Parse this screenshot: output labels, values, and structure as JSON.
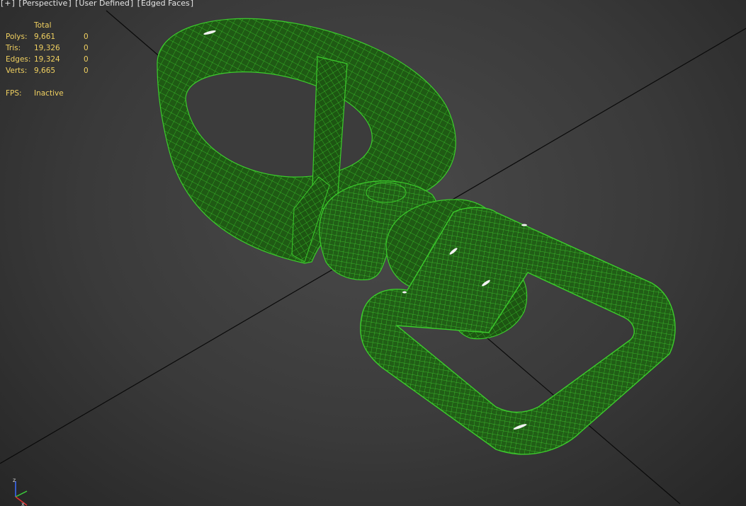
{
  "viewport_menu": {
    "plus": "+",
    "view": "Perspective",
    "shading_mode": "User Defined",
    "display": "Edged Faces"
  },
  "stats": {
    "header": "Total",
    "rows": [
      {
        "label": "Polys:",
        "total": "9,661",
        "selected": "0"
      },
      {
        "label": "Tris:",
        "total": "19,326",
        "selected": "0"
      },
      {
        "label": "Edges:",
        "total": "19,324",
        "selected": "0"
      },
      {
        "label": "Verts:",
        "total": "9,665",
        "selected": "0"
      }
    ],
    "fps_label": "FPS:",
    "fps_value": "Inactive"
  },
  "axis": {
    "z": "z",
    "x": "x"
  },
  "colors": {
    "mesh_fill": "#1f5a14",
    "wire": "#3ccc2c",
    "grid_line": "#000000",
    "stats_text": "#f0d060",
    "background": "#3a3a3a"
  },
  "icons": [
    "axis-tripod-icon"
  ]
}
